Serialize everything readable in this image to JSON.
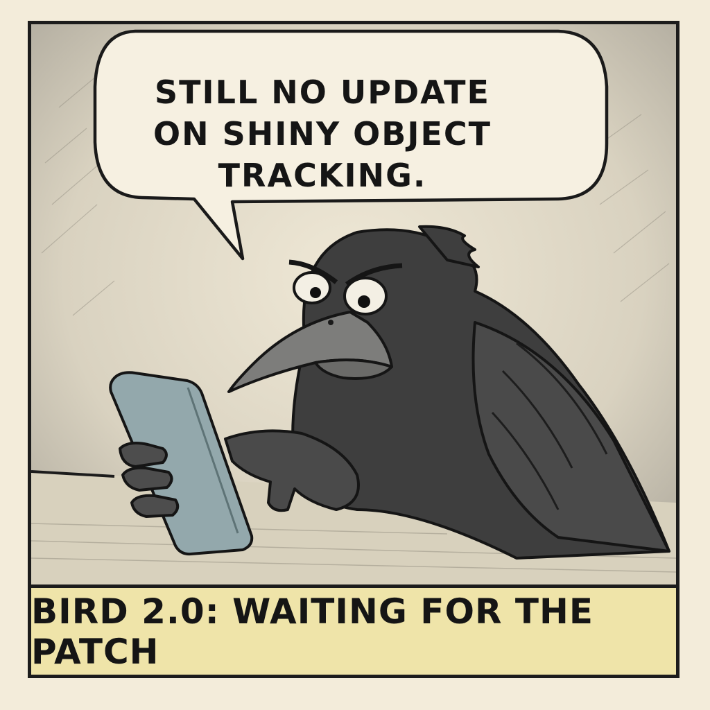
{
  "comic": {
    "speech_lines": [
      "STILL NO UPDATE",
      "ON SHINY OBJECT",
      "TRACKING."
    ],
    "caption": "BIRD 2.0: WAITING FOR THE PATCH"
  },
  "colors": {
    "paper": "#f3ecda",
    "panel_bg": "#ece5d2",
    "ink": "#1c1c1c",
    "crow_body": "#3e3e3e",
    "crow_beak": "#7d7d7b",
    "phone": "#93a8ac",
    "caption_bg": "#efe4a9"
  },
  "icons": {
    "character": "crow-icon",
    "device": "smartphone-icon"
  }
}
